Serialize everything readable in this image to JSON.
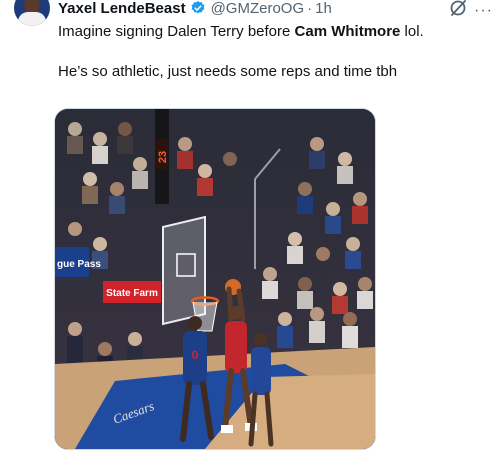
{
  "tweet": {
    "author_name": "Yaxel LendeBeast",
    "handle": "@GMZeroOG",
    "separator": "·",
    "time": "1h",
    "text_before": "Imagine signing Dalen Terry before ",
    "text_bold": "Cam Whitmore",
    "text_after": " lol.",
    "line2": "He’s so athletic, just needs some reps and time tbh"
  },
  "media": {
    "ad_banner": "State Farm",
    "side_banner": "gue Pass",
    "floor_text": "Caesars",
    "player_number": "0"
  },
  "icons": {
    "verified": "verified-badge-icon",
    "grok": "grok-icon",
    "more": "more-options-icon"
  },
  "colors": {
    "verified": "#1d9bf0",
    "text": "#0f1419",
    "secondary": "#536471"
  }
}
